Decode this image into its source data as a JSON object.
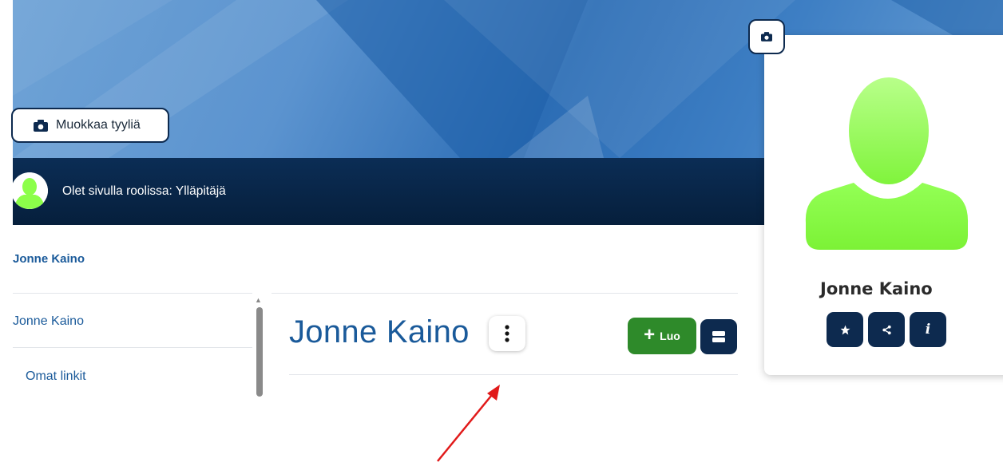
{
  "banner": {
    "edit_style_label": "Muokkaa tyyliä",
    "camera_icon": "camera-icon"
  },
  "role_bar": {
    "text": "Olet sivulla roolissa: Ylläpitäjä"
  },
  "breadcrumb": {
    "label": "Jonne Kaino"
  },
  "sidebar": {
    "items": [
      {
        "label": "Jonne Kaino"
      },
      {
        "label": "Omat linkit"
      }
    ]
  },
  "main": {
    "title": "Jonne Kaino",
    "create_label": "Luo",
    "menu_icon": "vertical-ellipsis-icon",
    "layout_icon": "layout-icon"
  },
  "profile": {
    "name": "Jonne Kaino",
    "actions": [
      "star-icon",
      "share-icon",
      "info-icon"
    ]
  },
  "colors": {
    "brand_dark": "#0d2a4f",
    "title_blue": "#1a5a9a",
    "create_green": "#2e8a2a",
    "avatar_green": "#8cff4a",
    "arrow_red": "#e11a1a"
  }
}
